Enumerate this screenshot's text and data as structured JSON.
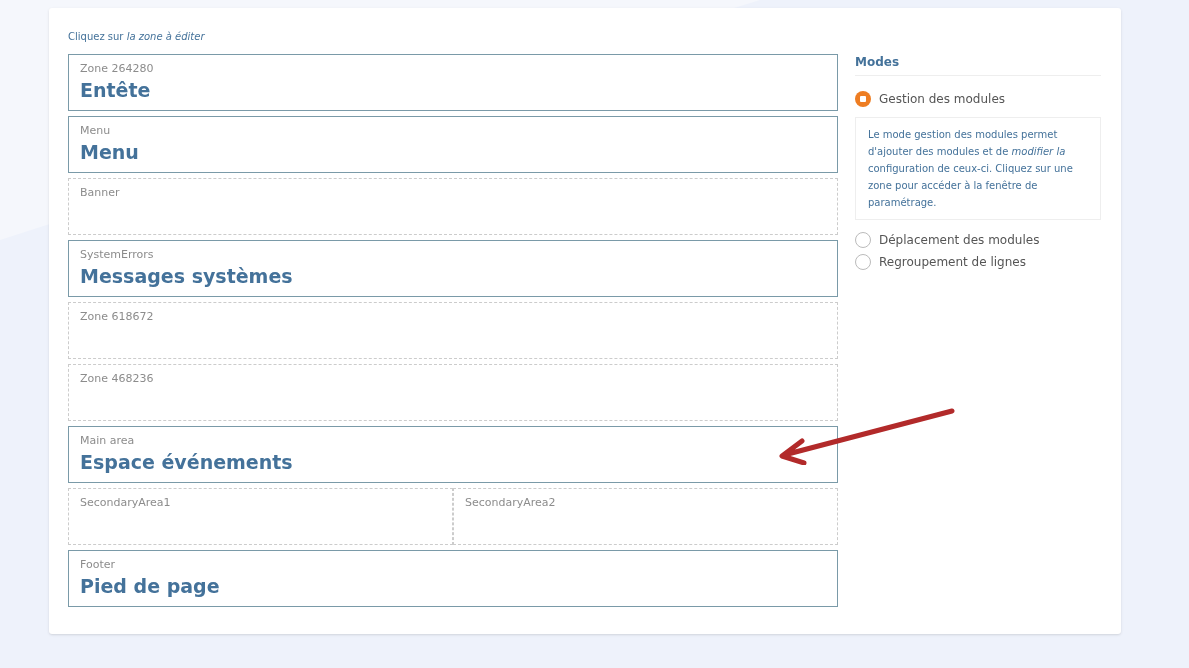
{
  "instruction": "Cliquez sur *la zone à éditer*",
  "rows": [
    {
      "zones": [
        {
          "label": "Zone 264280",
          "title": "Entête",
          "configured": true
        }
      ]
    },
    {
      "zones": [
        {
          "label": "Menu",
          "title": "Menu",
          "configured": true
        }
      ]
    },
    {
      "zones": [
        {
          "label": "Banner",
          "configured": false
        }
      ]
    },
    {
      "zones": [
        {
          "label": "SystemErrors",
          "title": "Messages systèmes",
          "configured": true
        }
      ]
    },
    {
      "zones": [
        {
          "label": "Zone 618672",
          "configured": false
        }
      ]
    },
    {
      "zones": [
        {
          "label": "Zone 468236",
          "configured": false
        }
      ]
    },
    {
      "zones": [
        {
          "label": "Main area",
          "title": "Espace événements",
          "configured": true
        }
      ]
    },
    {
      "zones": [
        {
          "label": "SecondaryArea1",
          "configured": false
        },
        {
          "label": "SecondaryArea2",
          "configured": false
        }
      ]
    },
    {
      "zones": [
        {
          "label": "Footer",
          "title": "Pied de page",
          "configured": true
        }
      ]
    }
  ],
  "modes": {
    "title": "Modes",
    "options": [
      {
        "label": "Gestion des modules",
        "selected": true,
        "description": "Le mode gestion des modules permet d'ajouter des modules et de *modifier la* configuration de ceux-ci. Cliquez sur une zone pour accéder à la fenêtre de paramétrage."
      },
      {
        "label": "Déplacement des modules",
        "selected": false
      },
      {
        "label": "Regroupement de lignes",
        "selected": false
      }
    ]
  }
}
